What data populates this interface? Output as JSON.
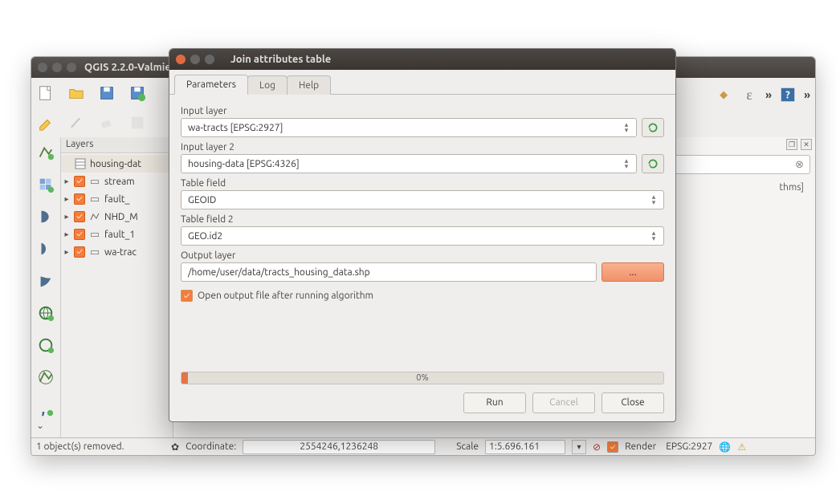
{
  "qgis": {
    "title": "QGIS 2.2.0-Valmiera -",
    "layers_label": "Layers",
    "layers": [
      {
        "name": "housing-dat",
        "checked": false,
        "icon": "table",
        "expandable": false
      },
      {
        "name": "stream",
        "checked": true,
        "icon": "vector",
        "expandable": true
      },
      {
        "name": "fault_",
        "checked": true,
        "icon": "vector",
        "expandable": true
      },
      {
        "name": "NHD_M",
        "checked": true,
        "icon": "line",
        "expandable": true
      },
      {
        "name": "fault_1",
        "checked": true,
        "icon": "vector",
        "expandable": true
      },
      {
        "name": "wa-trac",
        "checked": true,
        "icon": "vector",
        "expandable": true
      }
    ],
    "right_panel_hint": "thms]",
    "status": {
      "message": "1 object(s) removed.",
      "coord_label": "Coordinate:",
      "coord_value": "2554246,1236248",
      "scale_label": "Scale",
      "scale_value": "1:5.696.161",
      "render_label": "Render",
      "epsg": "EPSG:2927"
    }
  },
  "dialog": {
    "title": "Join attributes table",
    "tabs": {
      "parameters": "Parameters",
      "log": "Log",
      "help": "Help"
    },
    "input_layer_label": "Input layer",
    "input_layer_value": "wa-tracts [EPSG:2927]",
    "input_layer2_label": "Input layer 2",
    "input_layer2_value": "housing-data [EPSG:4326]",
    "table_field_label": "Table field",
    "table_field_value": "GEOID",
    "table_field2_label": "Table field 2",
    "table_field2_value": "GEO.id2",
    "output_label": "Output layer",
    "output_value": "/home/user/data/tracts_housing_data.shp",
    "browse_label": "...",
    "open_output_label": "Open output file after running algorithm",
    "progress_label": "0%",
    "run_label": "Run",
    "cancel_label": "Cancel",
    "close_label": "Close"
  }
}
